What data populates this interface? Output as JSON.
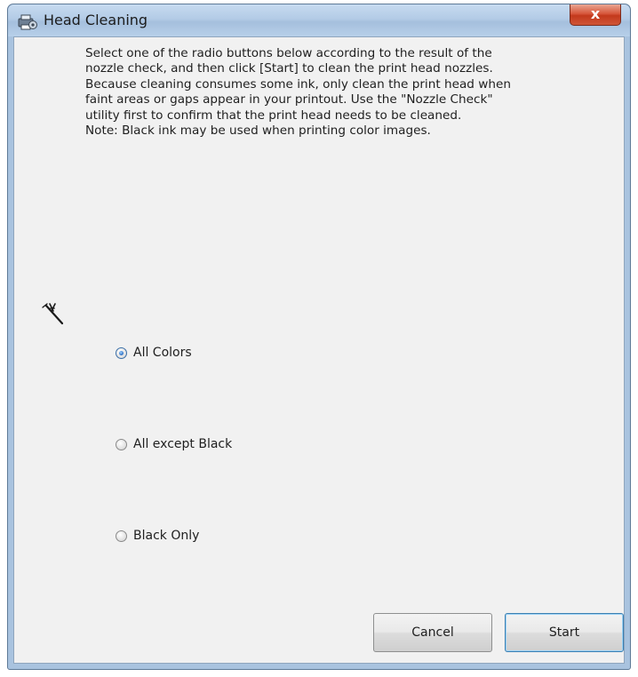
{
  "window": {
    "title": "Head Cleaning",
    "close_glyph": "x",
    "icon": "printer-settings-icon"
  },
  "description": {
    "lines": [
      "Select one of the radio buttons below according to the result of the",
      "nozzle check, and then click [Start] to clean the print head nozzles.",
      "Because cleaning consumes some ink, only clean the print head when",
      "faint areas or gaps appear in your printout. Use the \"Nozzle Check\"",
      "utility first to confirm that the print head needs to be cleaned.",
      "Note: Black ink may be used when printing color images."
    ]
  },
  "illustration": {
    "icon": "wand-pointer-icon"
  },
  "options": [
    {
      "label": "All Colors",
      "selected": true
    },
    {
      "label": "All except Black",
      "selected": false
    },
    {
      "label": "Black Only",
      "selected": false
    }
  ],
  "buttons": {
    "cancel": "Cancel",
    "start": "Start"
  }
}
